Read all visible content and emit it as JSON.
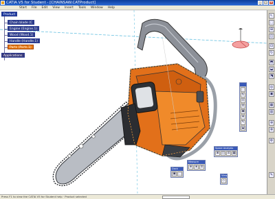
{
  "window": {
    "title": "CATIA V5 for Student - [CHAINSAW.CATProduct]",
    "buttons": [
      "_",
      "□",
      "×"
    ]
  },
  "menu": [
    "Start",
    "File",
    "Edit",
    "View",
    "Insert",
    "Tools",
    "Window",
    "Help"
  ],
  "tree": {
    "root": "Product",
    "children": [
      "Chain blade (C",
      "Engine (Engine.1)",
      "Wood (Wood.1)",
      "Handle (Handle.1)",
      "Parts (Parts.1)"
    ],
    "applications": "Applications"
  },
  "toolbars": {
    "right_icons": [
      "↖",
      "⬚",
      "⊞",
      "◫",
      "⊡",
      "↻",
      "⬒",
      "⬓",
      "⬔",
      "◎",
      "▣",
      "▦",
      "▥",
      "⊕",
      "⊗",
      "⚙",
      "✎"
    ],
    "vertical": {
      "icons": [
        "⬚",
        "↻",
        "◎",
        "⊡",
        "▣",
        "⊕",
        "✎",
        "⬓"
      ]
    },
    "space_analysis": {
      "title": "Space Analysis",
      "icons": [
        "⊞",
        "◫",
        "⊡",
        "▦"
      ]
    },
    "measure": {
      "title": "Measure",
      "icons": [
        "⊕",
        "⊗",
        "⊡"
      ]
    },
    "dock": {
      "title": "Dock",
      "icons": [
        "▣",
        "⬚"
      ]
    },
    "view": {
      "title": "View",
      "icons": [
        "◇"
      ]
    }
  },
  "status": {
    "text": "Press F1 to view the CATIA V5 for Student help · Product selected"
  },
  "colors": {
    "saw_orange": "#e2701a",
    "blade_gray": "#b9bdc4",
    "handle_gray": "#8c9098",
    "tree_blue": "#1f3a9e",
    "selection_orange": "#e87810"
  }
}
